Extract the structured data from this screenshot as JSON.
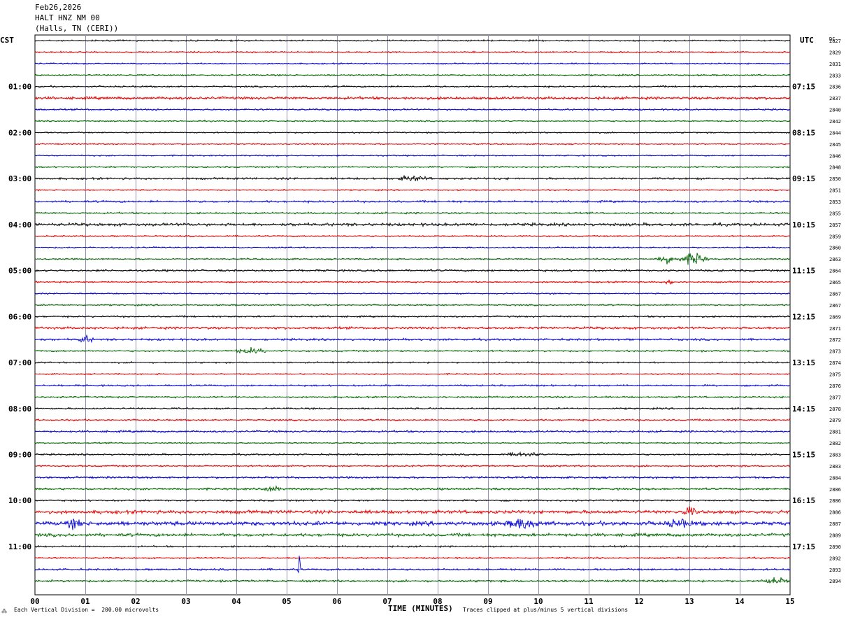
{
  "header": {
    "date": "Feb26,2026",
    "station": "HALT HNZ NM 00",
    "location": "(Halls, TN (CERI))"
  },
  "footer": {
    "mark": "⁂",
    "scale": "Each Vertical Division =  200.00 microvolts",
    "xtitle": "TIME (MINUTES)",
    "clip": "Traces clipped at plus/minus 5 vertical divisions"
  },
  "colors": {
    "trace_cycle": [
      "#000000",
      "#e00000",
      "#0000d0",
      "#006400"
    ],
    "grid": "#9090b0"
  },
  "chart_data": {
    "type": "line",
    "subtype": "helicorder",
    "left_tz": "CST",
    "right_tz": "UTC",
    "dc_header": "DC",
    "x_ticks": [
      "00",
      "01",
      "02",
      "03",
      "04",
      "05",
      "06",
      "07",
      "08",
      "09",
      "10",
      "11",
      "12",
      "13",
      "14",
      "15"
    ],
    "xlim": [
      0,
      15
    ],
    "left_hour_labels": [
      "01:00",
      "02:00",
      "03:00",
      "04:00",
      "05:00",
      "06:00",
      "07:00",
      "08:00",
      "09:00",
      "10:00",
      "11:00"
    ],
    "right_hour_labels": [
      "07:15",
      "08:15",
      "09:15",
      "10:15",
      "11:15",
      "12:15",
      "13:15",
      "14:15",
      "15:15",
      "16:15",
      "17:15"
    ],
    "dc_offsets": [
      "2827",
      "2829",
      "2831",
      "2833",
      "2836",
      "2837",
      "2840",
      "2842",
      "2844",
      "2845",
      "2846",
      "2848",
      "2850",
      "2851",
      "2853",
      "2855",
      "2857",
      "2859",
      "2860",
      "2863",
      "2864",
      "2865",
      "2867",
      "2867",
      "2869",
      "2871",
      "2872",
      "2873",
      "2874",
      "2875",
      "2876",
      "2877",
      "2878",
      "2879",
      "2881",
      "2882",
      "2883",
      "2883",
      "2884",
      "2886",
      "2886",
      "2886",
      "2887",
      "2889",
      "2890",
      "2892",
      "2893",
      "2894"
    ],
    "traces": [
      {
        "noise": 0.9
      },
      {
        "noise": 0.9
      },
      {
        "noise": 0.8
      },
      {
        "noise": 0.9
      },
      {
        "noise": 1.0
      },
      {
        "noise": 1.6
      },
      {
        "noise": 1.0
      },
      {
        "noise": 0.8
      },
      {
        "noise": 0.8
      },
      {
        "noise": 0.8
      },
      {
        "noise": 0.8
      },
      {
        "noise": 0.9
      },
      {
        "noise": 1.2,
        "bursts": [
          {
            "t": 7.5,
            "amp": 3,
            "w": 0.4
          }
        ]
      },
      {
        "noise": 0.8
      },
      {
        "noise": 1.2
      },
      {
        "noise": 1.0
      },
      {
        "noise": 1.7
      },
      {
        "noise": 0.8
      },
      {
        "noise": 0.8
      },
      {
        "noise": 0.9,
        "bursts": [
          {
            "t": 12.6,
            "amp": 6,
            "w": 0.3
          },
          {
            "t": 13.1,
            "amp": 8,
            "w": 0.3
          }
        ]
      },
      {
        "noise": 1.2
      },
      {
        "noise": 0.9,
        "bursts": [
          {
            "t": 12.6,
            "amp": 4,
            "w": 0.1
          }
        ]
      },
      {
        "noise": 0.8
      },
      {
        "noise": 0.9
      },
      {
        "noise": 1.0
      },
      {
        "noise": 1.4
      },
      {
        "noise": 1.2,
        "bursts": [
          {
            "t": 1.0,
            "amp": 4,
            "w": 0.2
          }
        ]
      },
      {
        "noise": 1.0,
        "bursts": [
          {
            "t": 4.3,
            "amp": 3,
            "w": 0.4
          }
        ]
      },
      {
        "noise": 0.9
      },
      {
        "noise": 0.8
      },
      {
        "noise": 1.0
      },
      {
        "noise": 1.0
      },
      {
        "noise": 1.0
      },
      {
        "noise": 1.0
      },
      {
        "noise": 1.2
      },
      {
        "noise": 0.8
      },
      {
        "noise": 1.0,
        "bursts": [
          {
            "t": 9.7,
            "amp": 3,
            "w": 0.4
          }
        ]
      },
      {
        "noise": 1.0
      },
      {
        "noise": 1.2
      },
      {
        "noise": 1.2,
        "bursts": [
          {
            "t": 4.7,
            "amp": 4,
            "w": 0.2
          }
        ]
      },
      {
        "noise": 1.0
      },
      {
        "noise": 2.0,
        "bursts": [
          {
            "t": 13.0,
            "amp": 5,
            "w": 0.2
          }
        ]
      },
      {
        "noise": 2.4,
        "bursts": [
          {
            "t": 0.8,
            "amp": 5,
            "w": 0.2
          },
          {
            "t": 9.7,
            "amp": 6,
            "w": 0.4
          },
          {
            "t": 12.8,
            "amp": 5,
            "w": 0.3
          }
        ]
      },
      {
        "noise": 1.8
      },
      {
        "noise": 1.0
      },
      {
        "noise": 0.9
      },
      {
        "noise": 1.1,
        "bursts": [
          {
            "t": 5.25,
            "amp": 26,
            "w": 0.03
          }
        ]
      },
      {
        "noise": 1.2,
        "bursts": [
          {
            "t": 14.7,
            "amp": 4,
            "w": 0.3
          }
        ]
      }
    ]
  }
}
